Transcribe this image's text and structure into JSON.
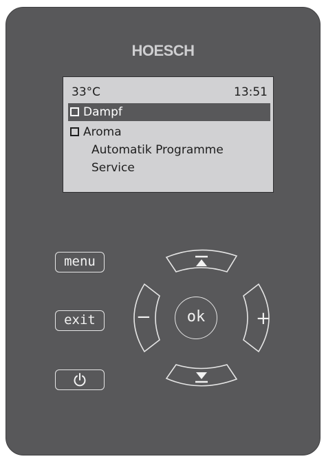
{
  "brand": "HOESCH",
  "display": {
    "temperature": "33°C",
    "time": "13:51",
    "menu": [
      {
        "label": "Dampf",
        "selected": true,
        "checkbox": true
      },
      {
        "label": "Aroma",
        "selected": false,
        "checkbox": true
      },
      {
        "label": "Automatik Programme",
        "selected": false,
        "checkbox": false
      },
      {
        "label": "Service",
        "selected": false,
        "checkbox": false
      }
    ]
  },
  "buttons": {
    "menu": "menu",
    "exit": "exit",
    "power_icon": "power-icon",
    "ok": "ok",
    "minus": "−",
    "plus": "+",
    "up_icon": "arrow-up-to-top-icon",
    "down_icon": "arrow-down-to-bottom-icon"
  },
  "colors": {
    "panel": "#58585a",
    "screen": "#d1d1d3",
    "selection": "#58585a",
    "button_outline": "#e6e6e6"
  }
}
